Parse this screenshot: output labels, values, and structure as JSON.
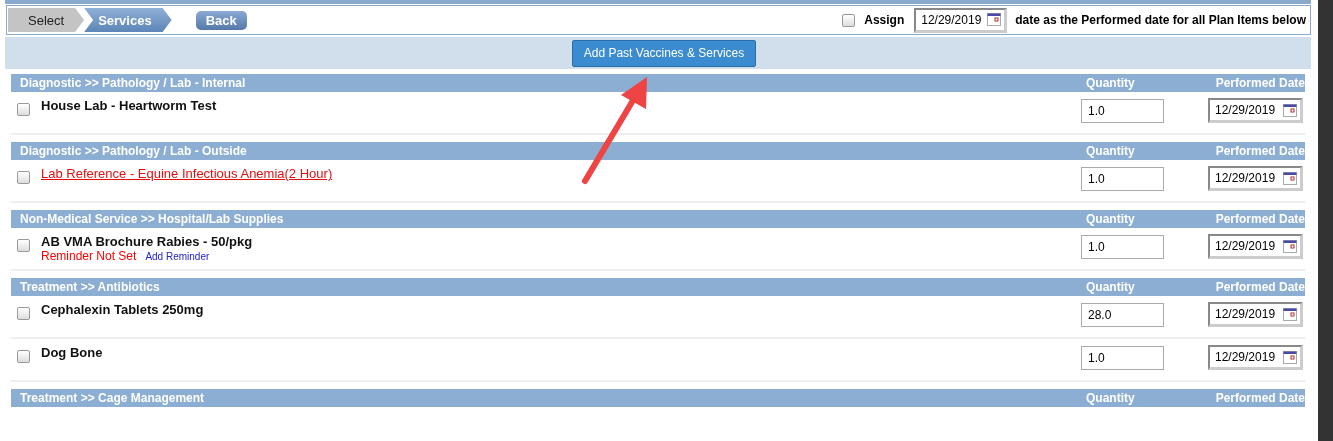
{
  "steps": [
    {
      "label": "Select",
      "selected": false
    },
    {
      "label": "Services",
      "selected": true
    }
  ],
  "back_button": "Back",
  "assign": {
    "checked": false,
    "label": "Assign",
    "date": "12/29/2019",
    "suffix": "date as the Performed date for all Plan Items below"
  },
  "add_button": "Add Past Vaccines & Services",
  "sections": [
    {
      "title": "Diagnostic >> Pathology / Lab - Internal",
      "quantity_header": "Quantity",
      "date_header": "Performed Date",
      "items": [
        {
          "name": "House Lab - Heartworm Test",
          "kind": "plain",
          "checked": false,
          "quantity": "1.0",
          "date": "12/29/2019"
        }
      ]
    },
    {
      "title": "Diagnostic >> Pathology / Lab - Outside",
      "quantity_header": "Quantity",
      "date_header": "Performed Date",
      "items": [
        {
          "name": "Lab Reference - Equine Infectious Anemia(2 Hour)",
          "kind": "link",
          "checked": false,
          "quantity": "1.0",
          "date": "12/29/2019"
        }
      ]
    },
    {
      "title": "Non-Medical Service >> Hospital/Lab Supplies",
      "quantity_header": "Quantity",
      "date_header": "Performed Date",
      "items": [
        {
          "name": "AB VMA Brochure Rabies - 50/pkg",
          "kind": "plain",
          "checked": false,
          "quantity": "1.0",
          "date": "12/29/2019",
          "reminder": "Reminder Not Set",
          "reminder_link": "Add Reminder"
        }
      ]
    },
    {
      "title": "Treatment >> Antibiotics",
      "quantity_header": "Quantity",
      "date_header": "Performed Date",
      "items": [
        {
          "name": "Cephalexin Tablets 250mg",
          "kind": "plain",
          "checked": false,
          "quantity": "28.0",
          "date": "12/29/2019"
        },
        {
          "name": "Dog Bone",
          "kind": "plain",
          "checked": false,
          "quantity": "1.0",
          "date": "12/29/2019"
        }
      ]
    },
    {
      "title": "Treatment >> Cage Management",
      "quantity_header": "Quantity",
      "date_header": "Performed Date"
    }
  ]
}
